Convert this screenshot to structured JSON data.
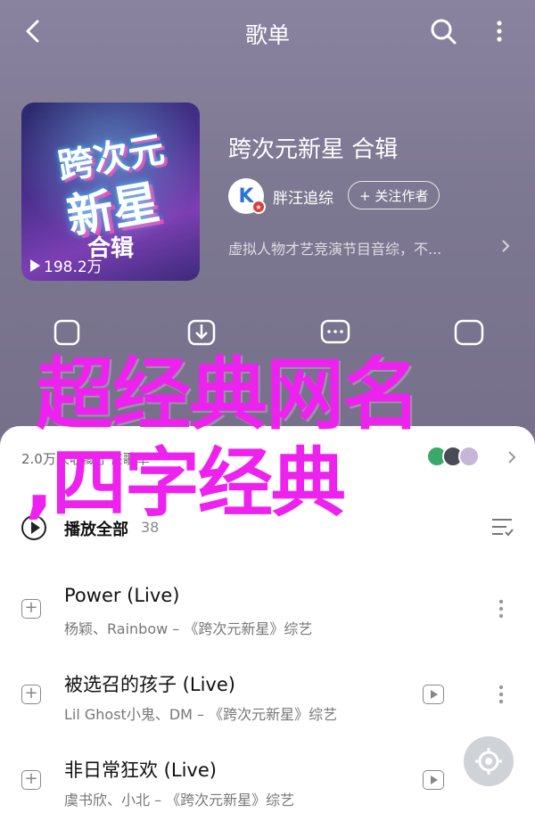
{
  "header": {
    "title": "歌单",
    "back_icon": "chevron-left-icon",
    "search_icon": "search-icon",
    "more_icon": "vertical-dots-icon"
  },
  "album": {
    "cover_logo_line1": "跨次元",
    "cover_logo_line2": "新星",
    "cover_subtitle": "合辑",
    "play_count": "198.2万",
    "title": "跨次元新星 合辑",
    "artist_initial": "K",
    "artist_name": "胖汪追综",
    "follow_label": "+ 关注作者",
    "description": "虚拟人物才艺竞演节目音综，不..."
  },
  "actions": [
    {
      "label": "",
      "icon": "share-icon"
    },
    {
      "label": "",
      "icon": "download-icon"
    },
    {
      "label": "",
      "icon": "comment-icon"
    },
    {
      "label": "",
      "icon": "favorite-icon"
    }
  ],
  "overlay": {
    "line1": "超经典网名",
    "line2": ",四字经典"
  },
  "fans": {
    "text": "2.0万人收藏了该歌单"
  },
  "play_all": {
    "label": "播放全部",
    "count": "38"
  },
  "songs": [
    {
      "title": "Power (Live)",
      "subtitle": "杨颖、Rainbow – 《跨次元新星》综艺",
      "has_mv": false
    },
    {
      "title": "被选召的孩子 (Live)",
      "subtitle": "Lil Ghost小鬼、DM – 《跨次元新星》综艺",
      "has_mv": true
    },
    {
      "title": "非日常狂欢 (Live)",
      "subtitle": "虞书欣、小北 – 《跨次元新星》综艺",
      "has_mv": true
    }
  ],
  "colors": {
    "overlay_text": "#ee22ee",
    "header_bg": "#7d7891",
    "panel_bg": "#ffffff"
  }
}
